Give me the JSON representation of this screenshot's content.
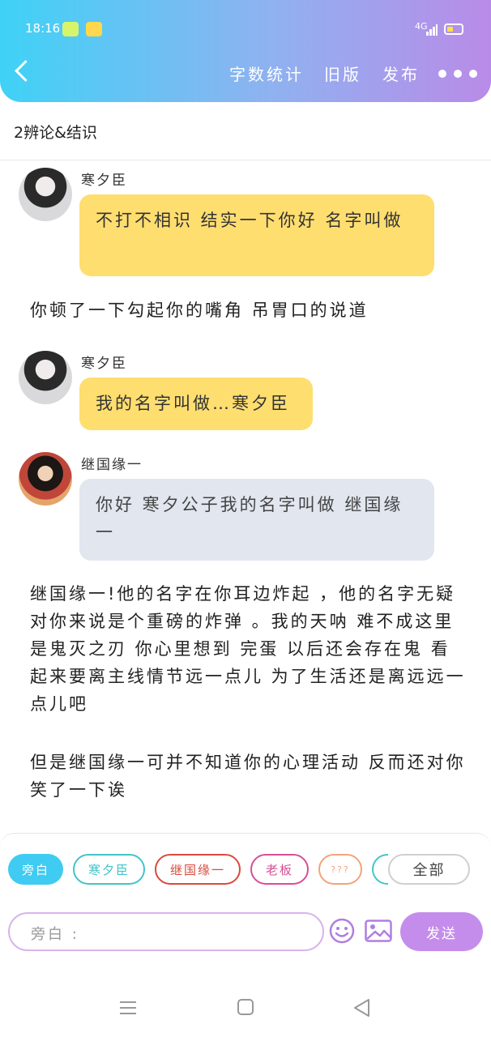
{
  "status_bar": {
    "time": "18:16",
    "network": "4G"
  },
  "header": {
    "back_icon": "chevron-left-icon",
    "buttons": [
      "字数统计",
      "旧版",
      "发布"
    ],
    "more_icon": "more-dots-icon"
  },
  "subtitle": "2辨论&结识",
  "messages": [
    {
      "speaker": "寒夕臣",
      "text": "不打不相识 结实一下你好 名字叫做"
    },
    {
      "narration": "你顿了一下勾起你的嘴角 吊胃口的说道"
    },
    {
      "speaker": "寒夕臣",
      "text": "我的名字叫做…寒夕臣"
    },
    {
      "speaker": "继国缘一",
      "text": "你好 寒夕公子我的名字叫做 继国缘一"
    },
    {
      "narration": "继国缘一!他的名字在你耳边炸起 ，他的名字无疑对你来说是个重磅的炸弹 。我的天呐 难不成这里是鬼灭之刃 你心里想到 完蛋 以后还会存在鬼 看起来要离主线情节远一点儿 为了生活还是离远远一点儿吧"
    },
    {
      "narration": "但是继国缘一可并不知道你的心理活动 反而还对你笑了一下诶"
    }
  ],
  "roles": [
    "旁白",
    "寒夕臣",
    "继国缘一",
    "老板",
    "???"
  ],
  "all_label": "全部",
  "input": {
    "placeholder": "旁白 :"
  },
  "send_label": "发送",
  "colors": {
    "header_start": "#3fd2f6",
    "header_end": "#b98be8",
    "bubble_yellow": "#ffde70",
    "bubble_grey": "#e1e6ef",
    "send": "#c58deb"
  }
}
